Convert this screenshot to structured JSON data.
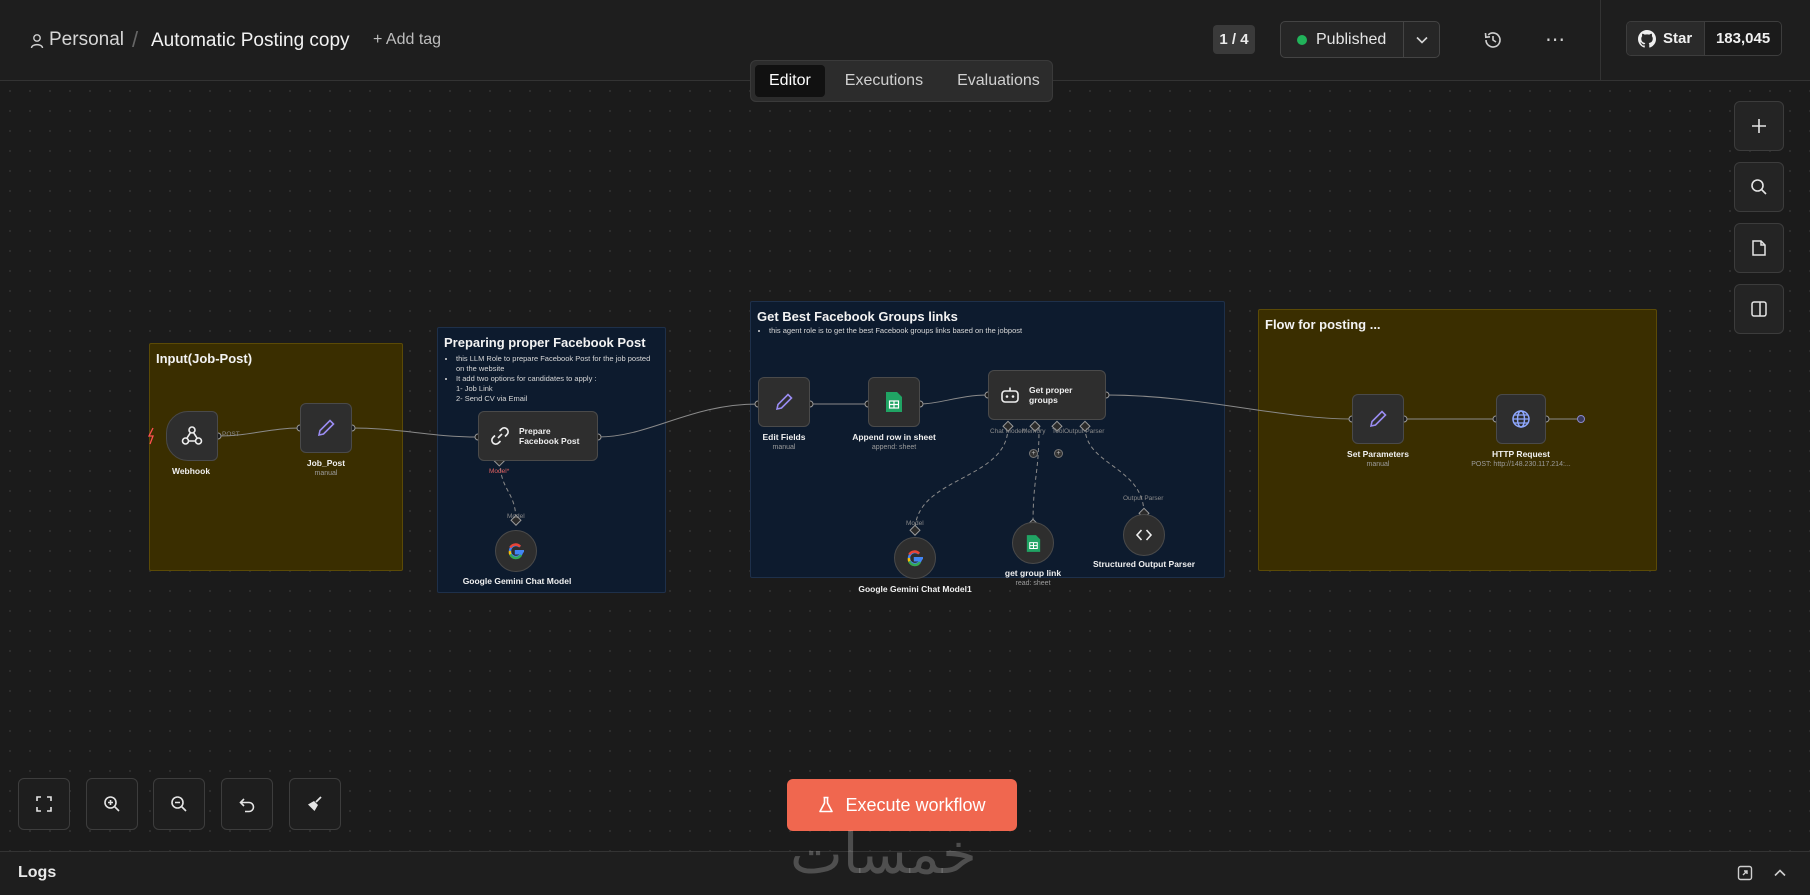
{
  "header": {
    "breadcrumb_project": "Personal",
    "breadcrumb_separator": "/",
    "workflow_title": "Automatic Posting copy",
    "add_tag": "+ Add tag",
    "page_counter": "1 / 4",
    "publish_status": "Published",
    "publish_status_color": "#21b35a",
    "more_icon": "⋯",
    "github_star_label": "Star",
    "github_star_count": "183,045"
  },
  "tabs": {
    "editor": "Editor",
    "executions": "Executions",
    "evaluations": "Evaluations",
    "active": "Editor"
  },
  "stickies": {
    "input": {
      "title": "Input(Job-Post)"
    },
    "facebook_post": {
      "title": "Preparing proper Facebook Post",
      "bullet1": "this LLM Role to prepare Facebook Post for the job posted on the website",
      "bullet2": "It add two options for candidates to apply :",
      "line1": "1- Job Link",
      "line2": "2- Send CV via Email"
    },
    "groups": {
      "title": "Get Best Facebook Groups links",
      "bullet1": "this agent role is to get the best Facebook groups links based on the jobpost"
    },
    "posting": {
      "title": "Flow for posting ..."
    }
  },
  "nodes": {
    "webhook": {
      "label": "Webhook",
      "port": "POST"
    },
    "job_post": {
      "label": "Job_Post",
      "sub": "manual"
    },
    "prepare_post": {
      "label_line1": "Prepare",
      "label_line2": "Facebook Post",
      "port_model": "Model*"
    },
    "gemini1": {
      "label": "Google Gemini Chat Model",
      "port": "Model"
    },
    "edit_fields": {
      "label": "Edit Fields",
      "sub": "manual"
    },
    "append_row": {
      "label": "Append row in sheet",
      "sub": "append: sheet"
    },
    "get_groups": {
      "label_line1": "Get proper",
      "label_line2": "groups",
      "port_chat_model": "Chat Model*",
      "port_memory": "Memory",
      "port_tool": "Tool",
      "port_output_parser": "Output Parser"
    },
    "gemini2": {
      "label": "Google Gemini Chat Model1",
      "port": "Model"
    },
    "get_group_link": {
      "label": "get group link",
      "sub": "read: sheet"
    },
    "structured_parser": {
      "label": "Structured Output Parser",
      "port": "Output Parser"
    },
    "set_params": {
      "label": "Set Parameters",
      "sub": "manual"
    },
    "http_request": {
      "label": "HTTP Request",
      "sub": "POST: http://148.230.117.214:..."
    }
  },
  "canvas_controls": {
    "zoom_to_fit": "fit-icon",
    "zoom_in": "zoom-in-icon",
    "zoom_out": "zoom-out-icon",
    "undo": "undo-icon",
    "tidy": "broom-icon"
  },
  "execute_button": "Execute workflow",
  "logs": {
    "title": "Logs"
  },
  "watermark": "خمسات"
}
